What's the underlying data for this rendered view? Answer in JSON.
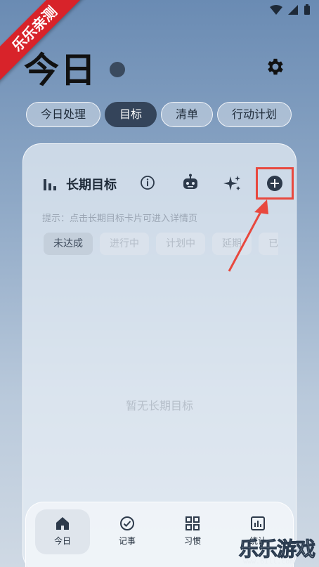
{
  "watermark_ribbon": "乐乐亲测",
  "header": {
    "title": "今日"
  },
  "tabs": [
    {
      "label": "今日处理",
      "active": false
    },
    {
      "label": "目标",
      "active": true
    },
    {
      "label": "清单",
      "active": false
    },
    {
      "label": "行动计划",
      "active": false
    }
  ],
  "card": {
    "title": "长期目标",
    "hint": "提示：点击长期目标卡片可进入详情页",
    "filters": [
      {
        "label": "未达成",
        "active": true
      },
      {
        "label": "进行中",
        "active": false
      },
      {
        "label": "计划中",
        "active": false
      },
      {
        "label": "延期",
        "active": false
      },
      {
        "label": "已",
        "active": false
      }
    ],
    "empty_text": "暂无长期目标"
  },
  "icons": {
    "settings": "gear-icon",
    "chart": "bar-chart-icon",
    "info": "info-icon",
    "robot": "robot-icon",
    "sparkle": "sparkle-icon",
    "add": "plus-circle-icon"
  },
  "bottom_nav": [
    {
      "label": "今日",
      "icon": "home-icon",
      "active": true
    },
    {
      "label": "记事",
      "icon": "check-circle-icon",
      "active": false
    },
    {
      "label": "习惯",
      "icon": "grid-icon",
      "active": false
    },
    {
      "label": "统计",
      "icon": "chart-box-icon",
      "active": false
    }
  ],
  "watermark": {
    "text": "乐乐游戏",
    "url": "www.6ill.com"
  },
  "colors": {
    "accent": "#34445a",
    "highlight": "#e8483e",
    "ribbon": "#d8232a"
  }
}
